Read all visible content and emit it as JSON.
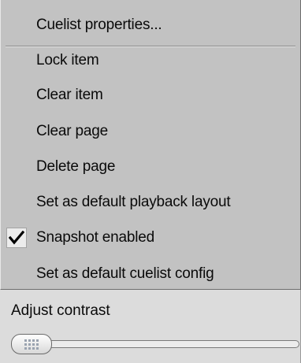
{
  "menu": {
    "items": [
      {
        "label": "Cuelist properties...",
        "checked": false
      },
      {
        "label": "Lock item",
        "checked": false
      },
      {
        "label": "Clear item",
        "checked": false
      },
      {
        "label": "Clear page",
        "checked": false
      },
      {
        "label": "Delete page",
        "checked": false
      },
      {
        "label": "Set as default playback layout",
        "checked": false
      },
      {
        "label": "Snapshot enabled",
        "checked": true
      },
      {
        "label": "Set as default cuelist config",
        "checked": false
      }
    ]
  },
  "contrast": {
    "label": "Adjust contrast",
    "value": 0.0
  },
  "icons": {
    "check": "checkmark-icon",
    "thumb_grip": "grip-icon"
  },
  "colors": {
    "menu_bg": "#c2c2c2",
    "panel_bg": "#dcdcdc",
    "text": "#0a0a0a"
  }
}
